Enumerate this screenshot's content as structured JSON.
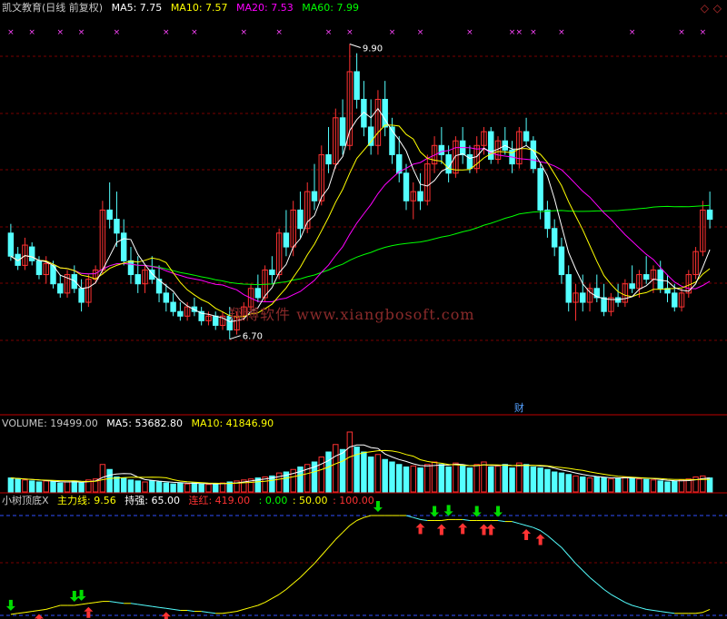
{
  "header_main": {
    "title": "凯文教育(日线 前复权)",
    "ma5_label": "MA5: 7.75",
    "ma10_label": "MA10: 7.57",
    "ma20_label": "MA20: 7.53",
    "ma60_label": "MA60: 7.99"
  },
  "header_volume": {
    "volume_label": "VOLUME: 19499.00",
    "ma5_label": "MA5: 53682.80",
    "ma10_label": "MA10: 41846.90"
  },
  "header_indicator": {
    "name": "小树顶底X",
    "main_line_label": "主力线: 9.56",
    "strong_label": "持强: 65.00",
    "red_label": "连红: 419.00",
    "level_0": ": 0.00",
    "level_50": ": 50.00",
    "level_100": ": 100.00"
  },
  "annotations": {
    "high_label": "9.90",
    "low_label": "6.70",
    "finance_marker": "财"
  },
  "watermark": "翔博软件 www.xiangbosoft.com",
  "colors": {
    "up": "#ff3232",
    "down": "#54ffff",
    "ma5": "#ffffff",
    "ma10": "#ffff00",
    "ma20": "#ff00ff",
    "ma60": "#00ff00",
    "main_line_high": "#ffff00",
    "main_line_low": "#54ffff",
    "grid": "#7a0000",
    "divider": "#c00000",
    "level_line": "#3050ff",
    "cross_marker": "#ff44ff",
    "arrow_green": "#00dd00",
    "arrow_red": "#ff3333"
  },
  "chart_data": [
    {
      "type": "candlestick",
      "title": "凯文教育(日线 前复权)",
      "yrange": [
        5.9,
        10.2
      ],
      "marked_high": 9.9,
      "marked_low": 6.7,
      "ohlc": [
        [
          7.85,
          7.95,
          7.55,
          7.6
        ],
        [
          7.62,
          7.7,
          7.45,
          7.5
        ],
        [
          7.5,
          7.8,
          7.45,
          7.72
        ],
        [
          7.7,
          7.75,
          7.5,
          7.55
        ],
        [
          7.55,
          7.6,
          7.35,
          7.4
        ],
        [
          7.4,
          7.6,
          7.3,
          7.52
        ],
        [
          7.5,
          7.55,
          7.25,
          7.3
        ],
        [
          7.3,
          7.4,
          7.15,
          7.2
        ],
        [
          7.2,
          7.45,
          7.15,
          7.4
        ],
        [
          7.4,
          7.5,
          7.2,
          7.25
        ],
        [
          7.25,
          7.35,
          7.0,
          7.1
        ],
        [
          7.1,
          7.4,
          7.05,
          7.35
        ],
        [
          7.35,
          7.5,
          7.3,
          7.45
        ],
        [
          7.45,
          8.2,
          7.4,
          8.1
        ],
        [
          8.1,
          8.4,
          7.9,
          8.0
        ],
        [
          8.0,
          8.3,
          7.7,
          7.85
        ],
        [
          7.85,
          8.0,
          7.5,
          7.55
        ],
        [
          7.55,
          7.7,
          7.3,
          7.4
        ],
        [
          7.4,
          7.6,
          7.2,
          7.3
        ],
        [
          7.3,
          7.5,
          7.2,
          7.45
        ],
        [
          7.45,
          7.6,
          7.3,
          7.35
        ],
        [
          7.35,
          7.5,
          7.1,
          7.2
        ],
        [
          7.2,
          7.3,
          7.0,
          7.1
        ],
        [
          7.1,
          7.2,
          6.95,
          7.0
        ],
        [
          7.0,
          7.1,
          6.9,
          6.95
        ],
        [
          6.95,
          7.1,
          6.9,
          7.05
        ],
        [
          7.05,
          7.15,
          6.95,
          7.0
        ],
        [
          7.0,
          7.05,
          6.85,
          6.9
        ],
        [
          6.9,
          7.0,
          6.85,
          6.95
        ],
        [
          6.95,
          7.0,
          6.8,
          6.85
        ],
        [
          6.85,
          7.0,
          6.8,
          6.95
        ],
        [
          6.95,
          7.05,
          6.7,
          6.8
        ],
        [
          6.8,
          7.0,
          6.75,
          6.95
        ],
        [
          6.95,
          7.1,
          6.9,
          7.05
        ],
        [
          7.05,
          7.3,
          7.0,
          7.25
        ],
        [
          7.25,
          7.4,
          7.1,
          7.15
        ],
        [
          7.15,
          7.5,
          7.1,
          7.45
        ],
        [
          7.45,
          7.6,
          7.3,
          7.4
        ],
        [
          7.4,
          7.9,
          7.35,
          7.85
        ],
        [
          7.85,
          8.1,
          7.6,
          7.7
        ],
        [
          7.7,
          8.2,
          7.6,
          8.1
        ],
        [
          8.1,
          8.3,
          7.8,
          7.9
        ],
        [
          7.9,
          8.4,
          7.85,
          8.3
        ],
        [
          8.3,
          8.6,
          8.1,
          8.2
        ],
        [
          8.2,
          8.8,
          8.15,
          8.7
        ],
        [
          8.7,
          9.0,
          8.5,
          8.6
        ],
        [
          8.6,
          9.2,
          8.55,
          9.1
        ],
        [
          9.1,
          9.3,
          8.7,
          8.8
        ],
        [
          8.8,
          9.9,
          8.75,
          9.6
        ],
        [
          9.6,
          9.8,
          9.2,
          9.3
        ],
        [
          9.3,
          9.5,
          8.9,
          9.0
        ],
        [
          9.0,
          9.3,
          8.7,
          8.8
        ],
        [
          8.8,
          9.4,
          8.7,
          9.3
        ],
        [
          9.3,
          9.5,
          8.9,
          9.0
        ],
        [
          9.0,
          9.1,
          8.6,
          8.7
        ],
        [
          8.7,
          8.9,
          8.4,
          8.5
        ],
        [
          8.5,
          8.6,
          8.1,
          8.2
        ],
        [
          8.2,
          8.4,
          8.0,
          8.3
        ],
        [
          8.3,
          8.5,
          8.1,
          8.2
        ],
        [
          8.2,
          8.7,
          8.15,
          8.6
        ],
        [
          8.6,
          8.9,
          8.5,
          8.8
        ],
        [
          8.8,
          9.0,
          8.6,
          8.7
        ],
        [
          8.7,
          8.8,
          8.4,
          8.5
        ],
        [
          8.5,
          8.9,
          8.45,
          8.85
        ],
        [
          8.85,
          9.0,
          8.6,
          8.7
        ],
        [
          8.7,
          8.8,
          8.5,
          8.55
        ],
        [
          8.55,
          8.9,
          8.5,
          8.8
        ],
        [
          8.8,
          9.0,
          8.7,
          8.95
        ],
        [
          8.95,
          9.0,
          8.6,
          8.65
        ],
        [
          8.65,
          8.9,
          8.6,
          8.85
        ],
        [
          8.85,
          9.0,
          8.7,
          8.75
        ],
        [
          8.75,
          8.85,
          8.5,
          8.6
        ],
        [
          8.6,
          9.0,
          8.55,
          8.95
        ],
        [
          8.95,
          9.1,
          8.8,
          8.85
        ],
        [
          8.85,
          8.9,
          8.5,
          8.55
        ],
        [
          8.55,
          8.6,
          8.0,
          8.1
        ],
        [
          8.1,
          8.2,
          7.8,
          7.9
        ],
        [
          7.9,
          8.0,
          7.6,
          7.7
        ],
        [
          7.7,
          7.8,
          7.3,
          7.4
        ],
        [
          7.4,
          7.5,
          7.0,
          7.1
        ],
        [
          7.1,
          7.3,
          6.9,
          7.2
        ],
        [
          7.2,
          7.4,
          7.0,
          7.1
        ],
        [
          7.1,
          7.3,
          7.0,
          7.25
        ],
        [
          7.25,
          7.4,
          7.1,
          7.15
        ],
        [
          7.15,
          7.3,
          6.95,
          7.0
        ],
        [
          7.0,
          7.2,
          6.95,
          7.15
        ],
        [
          7.15,
          7.3,
          7.05,
          7.1
        ],
        [
          7.1,
          7.35,
          7.05,
          7.3
        ],
        [
          7.3,
          7.5,
          7.2,
          7.25
        ],
        [
          7.25,
          7.45,
          7.15,
          7.4
        ],
        [
          7.4,
          7.6,
          7.3,
          7.35
        ],
        [
          7.35,
          7.5,
          7.2,
          7.45
        ],
        [
          7.45,
          7.55,
          7.2,
          7.25
        ],
        [
          7.25,
          7.4,
          7.1,
          7.2
        ],
        [
          7.2,
          7.3,
          7.0,
          7.05
        ],
        [
          7.05,
          7.25,
          7.0,
          7.2
        ],
        [
          7.2,
          7.45,
          7.15,
          7.4
        ],
        [
          7.4,
          7.7,
          7.35,
          7.65
        ],
        [
          7.65,
          8.2,
          7.6,
          8.1
        ],
        [
          8.1,
          8.3,
          7.9,
          8.0
        ]
      ],
      "ma_lines": [
        {
          "name": "MA5",
          "value": 7.75
        },
        {
          "name": "MA10",
          "value": 7.57
        },
        {
          "name": "MA20",
          "value": 7.53
        },
        {
          "name": "MA60",
          "value": 7.99
        }
      ]
    },
    {
      "type": "bar",
      "title": "VOLUME",
      "volume_last": 19499.0,
      "ma5": 53682.8,
      "ma10": 41846.9,
      "values": [
        28,
        26,
        24,
        22,
        20,
        22,
        20,
        18,
        20,
        22,
        18,
        24,
        26,
        55,
        45,
        30,
        28,
        24,
        22,
        20,
        22,
        20,
        18,
        16,
        18,
        16,
        18,
        16,
        15,
        16,
        18,
        20,
        22,
        24,
        26,
        28,
        30,
        32,
        38,
        40,
        45,
        50,
        55,
        60,
        70,
        80,
        95,
        85,
        120,
        90,
        80,
        70,
        75,
        65,
        60,
        55,
        50,
        52,
        48,
        55,
        60,
        55,
        50,
        58,
        52,
        48,
        55,
        60,
        50,
        52,
        55,
        48,
        58,
        55,
        50,
        48,
        45,
        40,
        38,
        35,
        32,
        30,
        28,
        30,
        28,
        26,
        28,
        30,
        28,
        26,
        25,
        24,
        22,
        20,
        22,
        24,
        26,
        30,
        32,
        28
      ]
    },
    {
      "type": "line",
      "title": "小树顶底X",
      "yrange": [
        0,
        100
      ],
      "levels": [
        0,
        50,
        100
      ],
      "main_line_last": 9.56,
      "strong": 65.0,
      "red": 419.0,
      "values": [
        1,
        2,
        3,
        4,
        5,
        6,
        8,
        10,
        10,
        10,
        11,
        12,
        13,
        14,
        14,
        13,
        12,
        12,
        11,
        10,
        9,
        8,
        7,
        6,
        5,
        5,
        4,
        4,
        3,
        2,
        2,
        3,
        4,
        6,
        8,
        10,
        13,
        17,
        21,
        26,
        32,
        38,
        45,
        52,
        60,
        68,
        76,
        83,
        90,
        95,
        98,
        100,
        100,
        100,
        100,
        100,
        100,
        98,
        96,
        95,
        95,
        95,
        96,
        96,
        96,
        95,
        95,
        95,
        95,
        95,
        94,
        94,
        92,
        90,
        88,
        85,
        80,
        74,
        68,
        60,
        52,
        45,
        38,
        32,
        26,
        21,
        17,
        13,
        10,
        8,
        6,
        5,
        4,
        3,
        2,
        2,
        2,
        2,
        3,
        6
      ]
    }
  ]
}
